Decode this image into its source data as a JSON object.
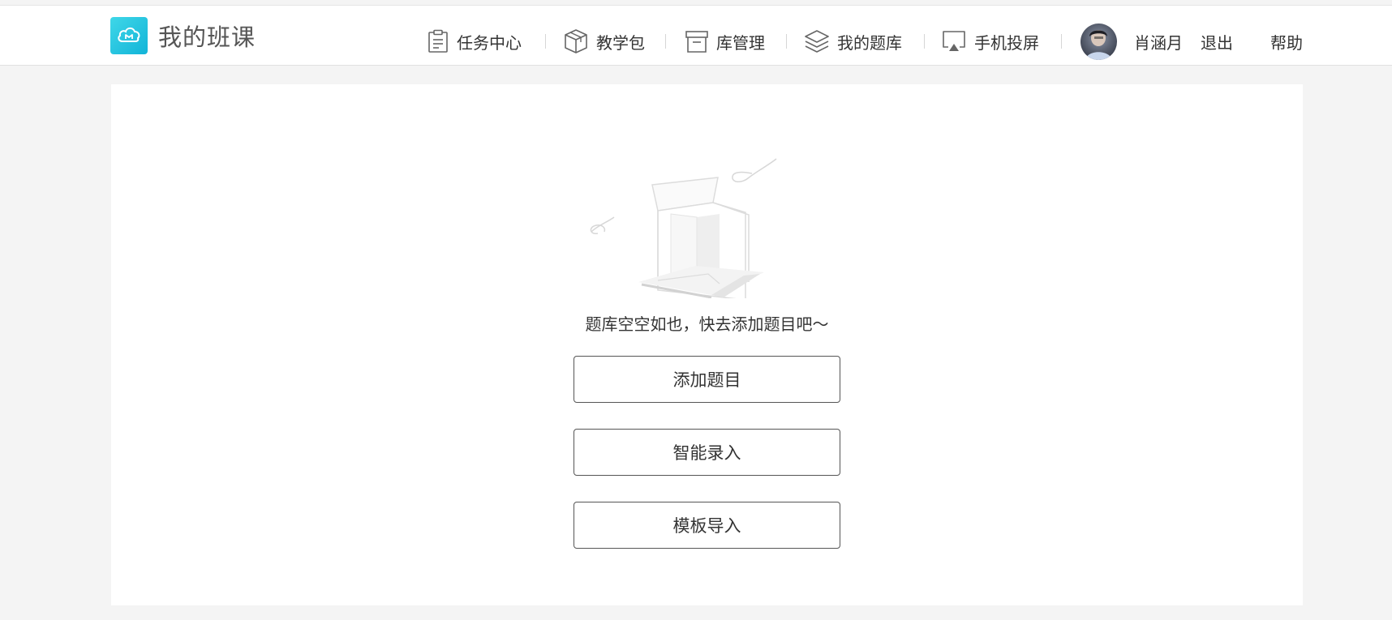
{
  "brand": {
    "name": "我的班课",
    "accent_color": "#1fc2dc",
    "icon": "cloud-icon"
  },
  "nav": {
    "items": [
      {
        "label": "任务中心",
        "icon": "clipboard-icon"
      },
      {
        "label": "教学包",
        "icon": "package-icon"
      },
      {
        "label": "库管理",
        "icon": "archive-icon"
      },
      {
        "label": "我的题库",
        "icon": "layers-icon"
      },
      {
        "label": "手机投屏",
        "icon": "airplay-icon"
      }
    ]
  },
  "user": {
    "name": "肖涵月",
    "logout_label": "退出",
    "help_label": "帮助"
  },
  "empty_state": {
    "message": "题库空空如也，快去添加题目吧～",
    "illustration": "empty-box-illustration"
  },
  "actions": {
    "add_question": "添加题目",
    "smart_entry": "智能录入",
    "template_import": "模板导入"
  }
}
